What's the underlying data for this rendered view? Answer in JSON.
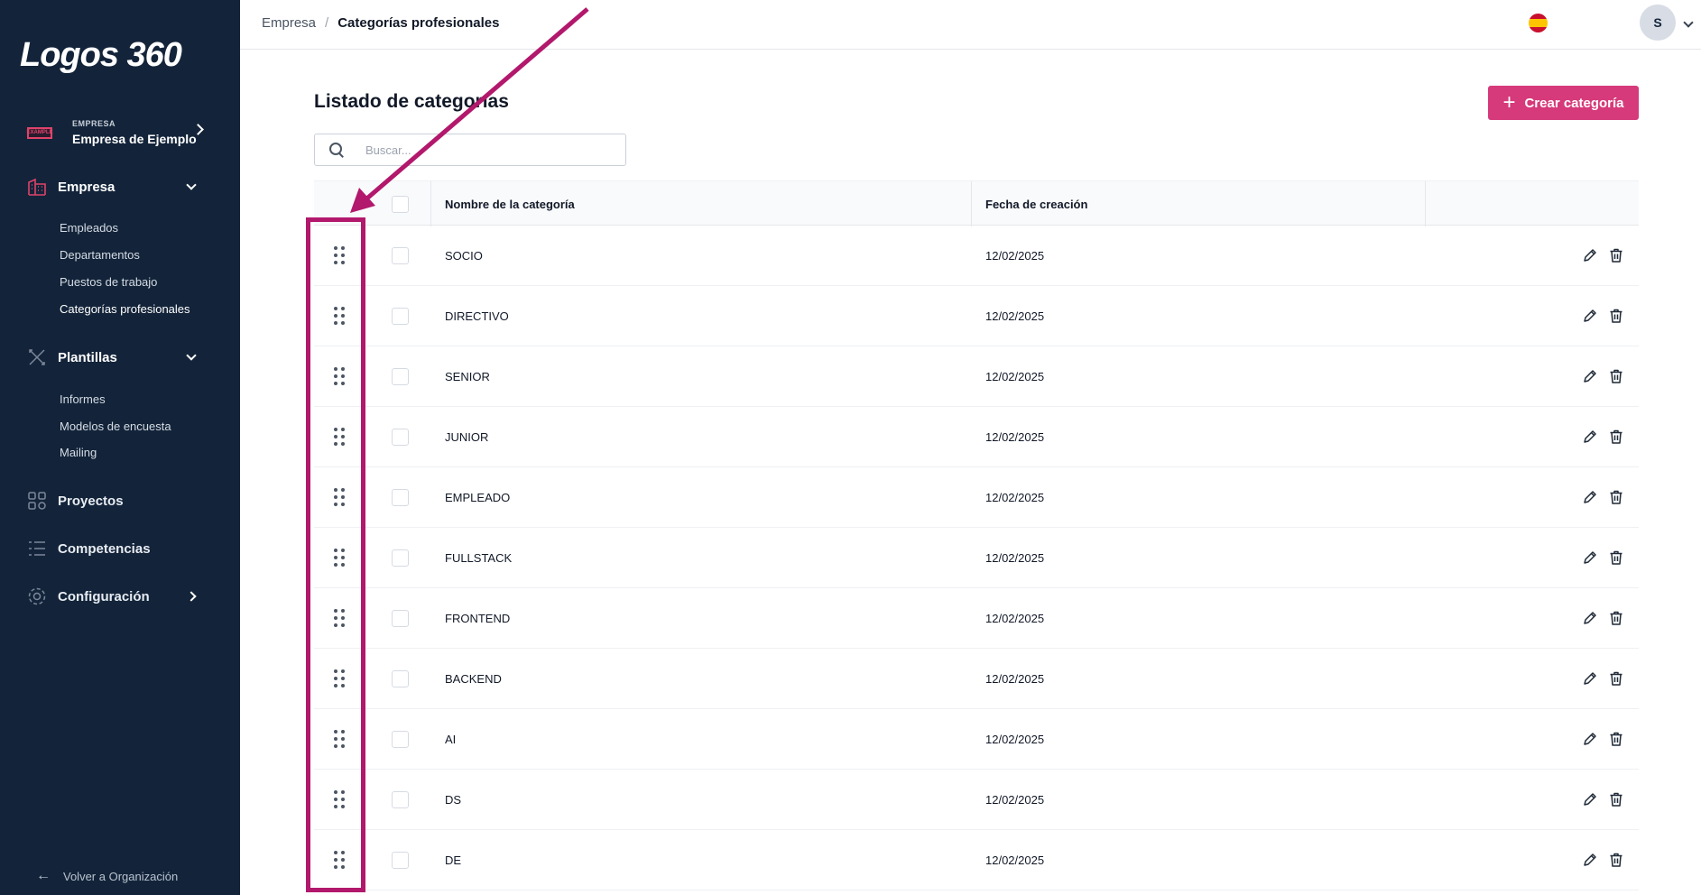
{
  "sidebar": {
    "logo": "Logos 360",
    "company": {
      "badge": "EXAMPLE",
      "small_label": "EMPRESA",
      "name": "Empresa de Ejemplo"
    },
    "sections": [
      {
        "label": "Empresa",
        "icon": "building-icon"
      },
      {
        "label": "Plantillas",
        "icon": "templates-icon"
      },
      {
        "label": "Proyectos",
        "icon": "projects-icon"
      },
      {
        "label": "Competencias",
        "icon": "list-icon"
      },
      {
        "label": "Configuración",
        "icon": "gear-icon"
      }
    ],
    "empresa_items": [
      "Empleados",
      "Departamentos",
      "Puestos de trabajo",
      "Categorías profesionales"
    ],
    "plantillas_items": [
      "Informes",
      "Modelos de encuesta",
      "Mailing"
    ],
    "back_label": "Volver a Organización"
  },
  "topbar": {
    "breadcrumb": [
      "Empresa",
      "Categorías profesionales"
    ],
    "avatar_initial": "S"
  },
  "main": {
    "title": "Listado de categorías",
    "create_label": "Crear categoría",
    "search_placeholder": "Buscar...",
    "columns": [
      "Nombre de la categoría",
      "Fecha de creación"
    ],
    "rows": [
      {
        "name": "SOCIO",
        "date": "12/02/2025"
      },
      {
        "name": "DIRECTIVO",
        "date": "12/02/2025"
      },
      {
        "name": "SENIOR",
        "date": "12/02/2025"
      },
      {
        "name": "JUNIOR",
        "date": "12/02/2025"
      },
      {
        "name": "EMPLEADO",
        "date": "12/02/2025"
      },
      {
        "name": "FULLSTACK",
        "date": "12/02/2025"
      },
      {
        "name": "FRONTEND",
        "date": "12/02/2025"
      },
      {
        "name": "BACKEND",
        "date": "12/02/2025"
      },
      {
        "name": "AI",
        "date": "12/02/2025"
      },
      {
        "name": "DS",
        "date": "12/02/2025"
      },
      {
        "name": "DE",
        "date": "12/02/2025"
      }
    ]
  },
  "colors": {
    "sidebar_bg": "#13243a",
    "accent": "#d63a7a",
    "annotation": "#b2186c"
  }
}
